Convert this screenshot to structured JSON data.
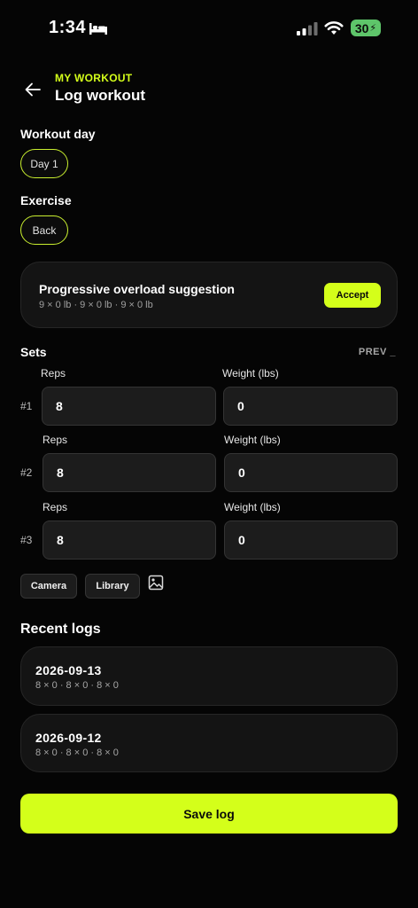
{
  "status_bar": {
    "time": "1:34",
    "battery": "30",
    "icons": [
      "bed-icon",
      "signal-icon",
      "wifi-icon",
      "battery-charging-icon"
    ]
  },
  "header": {
    "eyebrow": "MY WORKOUT",
    "title": "Log workout",
    "back_icon": "arrow-left-icon"
  },
  "workout_day": {
    "label": "Workout day",
    "selected": "Day 1"
  },
  "exercise": {
    "label": "Exercise",
    "selected": "Back"
  },
  "suggestion": {
    "title": "Progressive overload suggestion",
    "detail": "9 × 0 lb · 9 × 0 lb · 9 × 0 lb",
    "accept_label": "Accept"
  },
  "sets": {
    "title": "Sets",
    "prev_label": "PREV _",
    "rows": [
      {
        "num": "#1",
        "reps_label": "Reps",
        "reps": "8",
        "weight_label": "Weight (lbs)",
        "weight": "0"
      },
      {
        "num": "#2",
        "reps_label": "Reps",
        "reps": "8",
        "weight_label": "Weight (lbs)",
        "weight": "0"
      },
      {
        "num": "#3",
        "reps_label": "Reps",
        "reps": "8",
        "weight_label": "Weight (lbs)",
        "weight": "0"
      }
    ]
  },
  "media": {
    "camera_label": "Camera",
    "library_label": "Library",
    "image_icon": "image-icon"
  },
  "recent_logs": {
    "title": "Recent logs",
    "items": [
      {
        "date": "2026-09-13",
        "detail": "8 × 0 · 8 × 0 · 8 × 0"
      },
      {
        "date": "2026-09-12",
        "detail": "8 × 0 · 8 × 0 · 8 × 0"
      }
    ]
  },
  "save_label": "Save log",
  "colors": {
    "accent": "#d4ff1a",
    "background": "#050505",
    "card": "#141414",
    "field": "#1c1c1c",
    "battery": "#5ec56a"
  }
}
